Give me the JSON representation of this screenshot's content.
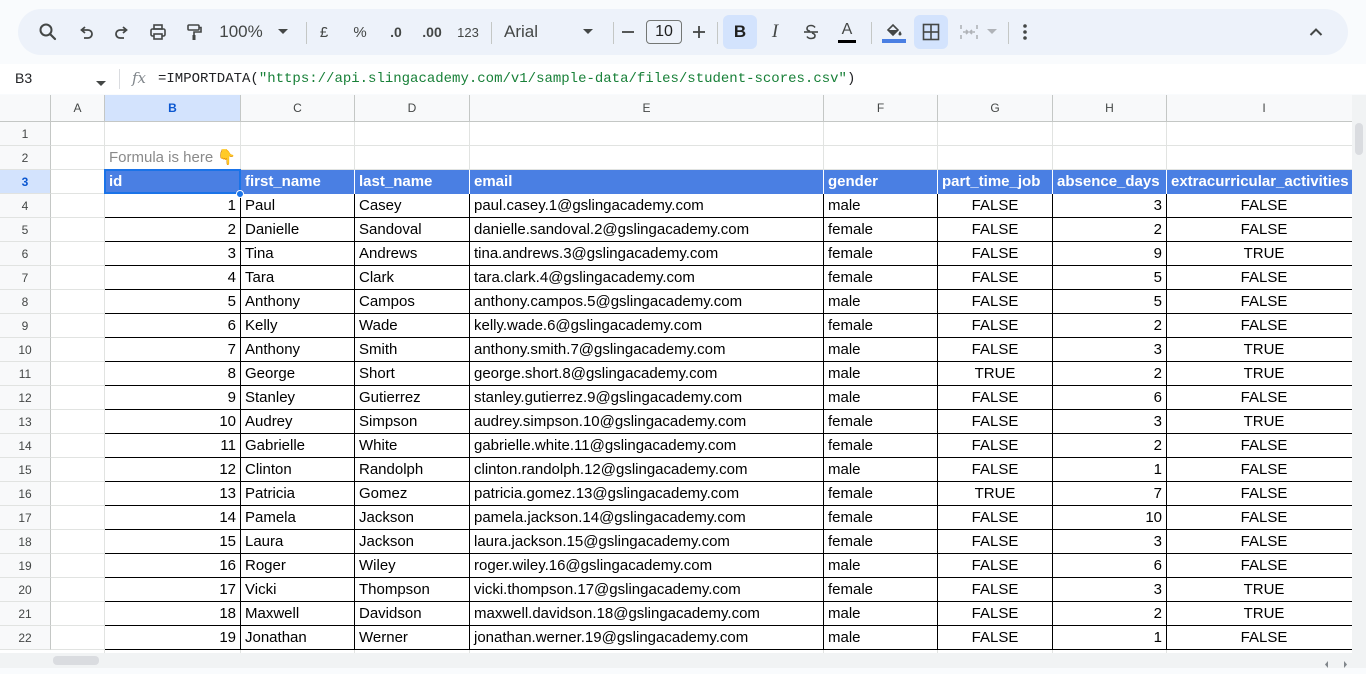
{
  "toolbar": {
    "zoom": "100%",
    "currency_symbol": "£",
    "percent_symbol": "%",
    "decrease_decimals": ".0",
    "increase_decimals": ".00",
    "number_format": "123",
    "font_name": "Arial",
    "font_size": "10",
    "bold_label": "B",
    "italic_label": "I",
    "text_color_label": "A",
    "fill_color": "#4a7fe3"
  },
  "formula_bar": {
    "cell_ref": "B3",
    "fx_label": "fx",
    "formula_prefix": "=IMPORTDATA(",
    "formula_url": "\"https://api.slingacademy.com/v1/sample-data/files/student-scores.csv\"",
    "formula_suffix": ")"
  },
  "columns": [
    "A",
    "B",
    "C",
    "D",
    "E",
    "F",
    "G",
    "H",
    "I"
  ],
  "row_numbers": [
    "1",
    "2",
    "3",
    "4",
    "5",
    "6",
    "7",
    "8",
    "9",
    "10",
    "11",
    "12",
    "13",
    "14",
    "15",
    "16",
    "17",
    "18",
    "19",
    "20",
    "21",
    "22"
  ],
  "note": "Formula is here 👇",
  "headers": [
    "id",
    "first_name",
    "last_name",
    "email",
    "gender",
    "part_time_job",
    "absence_days",
    "extracurricular_activities"
  ],
  "rows": [
    [
      "1",
      "Paul",
      "Casey",
      "paul.casey.1@gslingacademy.com",
      "male",
      "FALSE",
      "3",
      "FALSE"
    ],
    [
      "2",
      "Danielle",
      "Sandoval",
      "danielle.sandoval.2@gslingacademy.com",
      "female",
      "FALSE",
      "2",
      "FALSE"
    ],
    [
      "3",
      "Tina",
      "Andrews",
      "tina.andrews.3@gslingacademy.com",
      "female",
      "FALSE",
      "9",
      "TRUE"
    ],
    [
      "4",
      "Tara",
      "Clark",
      "tara.clark.4@gslingacademy.com",
      "female",
      "FALSE",
      "5",
      "FALSE"
    ],
    [
      "5",
      "Anthony",
      "Campos",
      "anthony.campos.5@gslingacademy.com",
      "male",
      "FALSE",
      "5",
      "FALSE"
    ],
    [
      "6",
      "Kelly",
      "Wade",
      "kelly.wade.6@gslingacademy.com",
      "female",
      "FALSE",
      "2",
      "FALSE"
    ],
    [
      "7",
      "Anthony",
      "Smith",
      "anthony.smith.7@gslingacademy.com",
      "male",
      "FALSE",
      "3",
      "TRUE"
    ],
    [
      "8",
      "George",
      "Short",
      "george.short.8@gslingacademy.com",
      "male",
      "TRUE",
      "2",
      "TRUE"
    ],
    [
      "9",
      "Stanley",
      "Gutierrez",
      "stanley.gutierrez.9@gslingacademy.com",
      "male",
      "FALSE",
      "6",
      "FALSE"
    ],
    [
      "10",
      "Audrey",
      "Simpson",
      "audrey.simpson.10@gslingacademy.com",
      "female",
      "FALSE",
      "3",
      "TRUE"
    ],
    [
      "11",
      "Gabrielle",
      "White",
      "gabrielle.white.11@gslingacademy.com",
      "female",
      "FALSE",
      "2",
      "FALSE"
    ],
    [
      "12",
      "Clinton",
      "Randolph",
      "clinton.randolph.12@gslingacademy.com",
      "male",
      "FALSE",
      "1",
      "FALSE"
    ],
    [
      "13",
      "Patricia",
      "Gomez",
      "patricia.gomez.13@gslingacademy.com",
      "female",
      "TRUE",
      "7",
      "FALSE"
    ],
    [
      "14",
      "Pamela",
      "Jackson",
      "pamela.jackson.14@gslingacademy.com",
      "female",
      "FALSE",
      "10",
      "FALSE"
    ],
    [
      "15",
      "Laura",
      "Jackson",
      "laura.jackson.15@gslingacademy.com",
      "female",
      "FALSE",
      "3",
      "FALSE"
    ],
    [
      "16",
      "Roger",
      "Wiley",
      "roger.wiley.16@gslingacademy.com",
      "male",
      "FALSE",
      "6",
      "FALSE"
    ],
    [
      "17",
      "Vicki",
      "Thompson",
      "vicki.thompson.17@gslingacademy.com",
      "female",
      "FALSE",
      "3",
      "TRUE"
    ],
    [
      "18",
      "Maxwell",
      "Davidson",
      "maxwell.davidson.18@gslingacademy.com",
      "male",
      "FALSE",
      "2",
      "TRUE"
    ],
    [
      "19",
      "Jonathan",
      "Werner",
      "jonathan.werner.19@gslingacademy.com",
      "male",
      "FALSE",
      "1",
      "FALSE"
    ]
  ],
  "colors": {
    "header_fill": "#4a7fe3",
    "header_text": "#ffffff",
    "selection": "#1a73e8",
    "selected_header": "#d3e3fd",
    "note_text": "#8a8a8a"
  },
  "icons": [
    "search-icon",
    "undo-icon",
    "redo-icon",
    "print-icon",
    "paint-format-icon",
    "zoom-dropdown-icon",
    "decrease-font-icon",
    "increase-font-icon",
    "strikethrough-icon",
    "fill-color-icon",
    "borders-icon",
    "merge-cells-icon",
    "more-vert-icon",
    "collapse-toolbar-icon",
    "fx-icon"
  ]
}
